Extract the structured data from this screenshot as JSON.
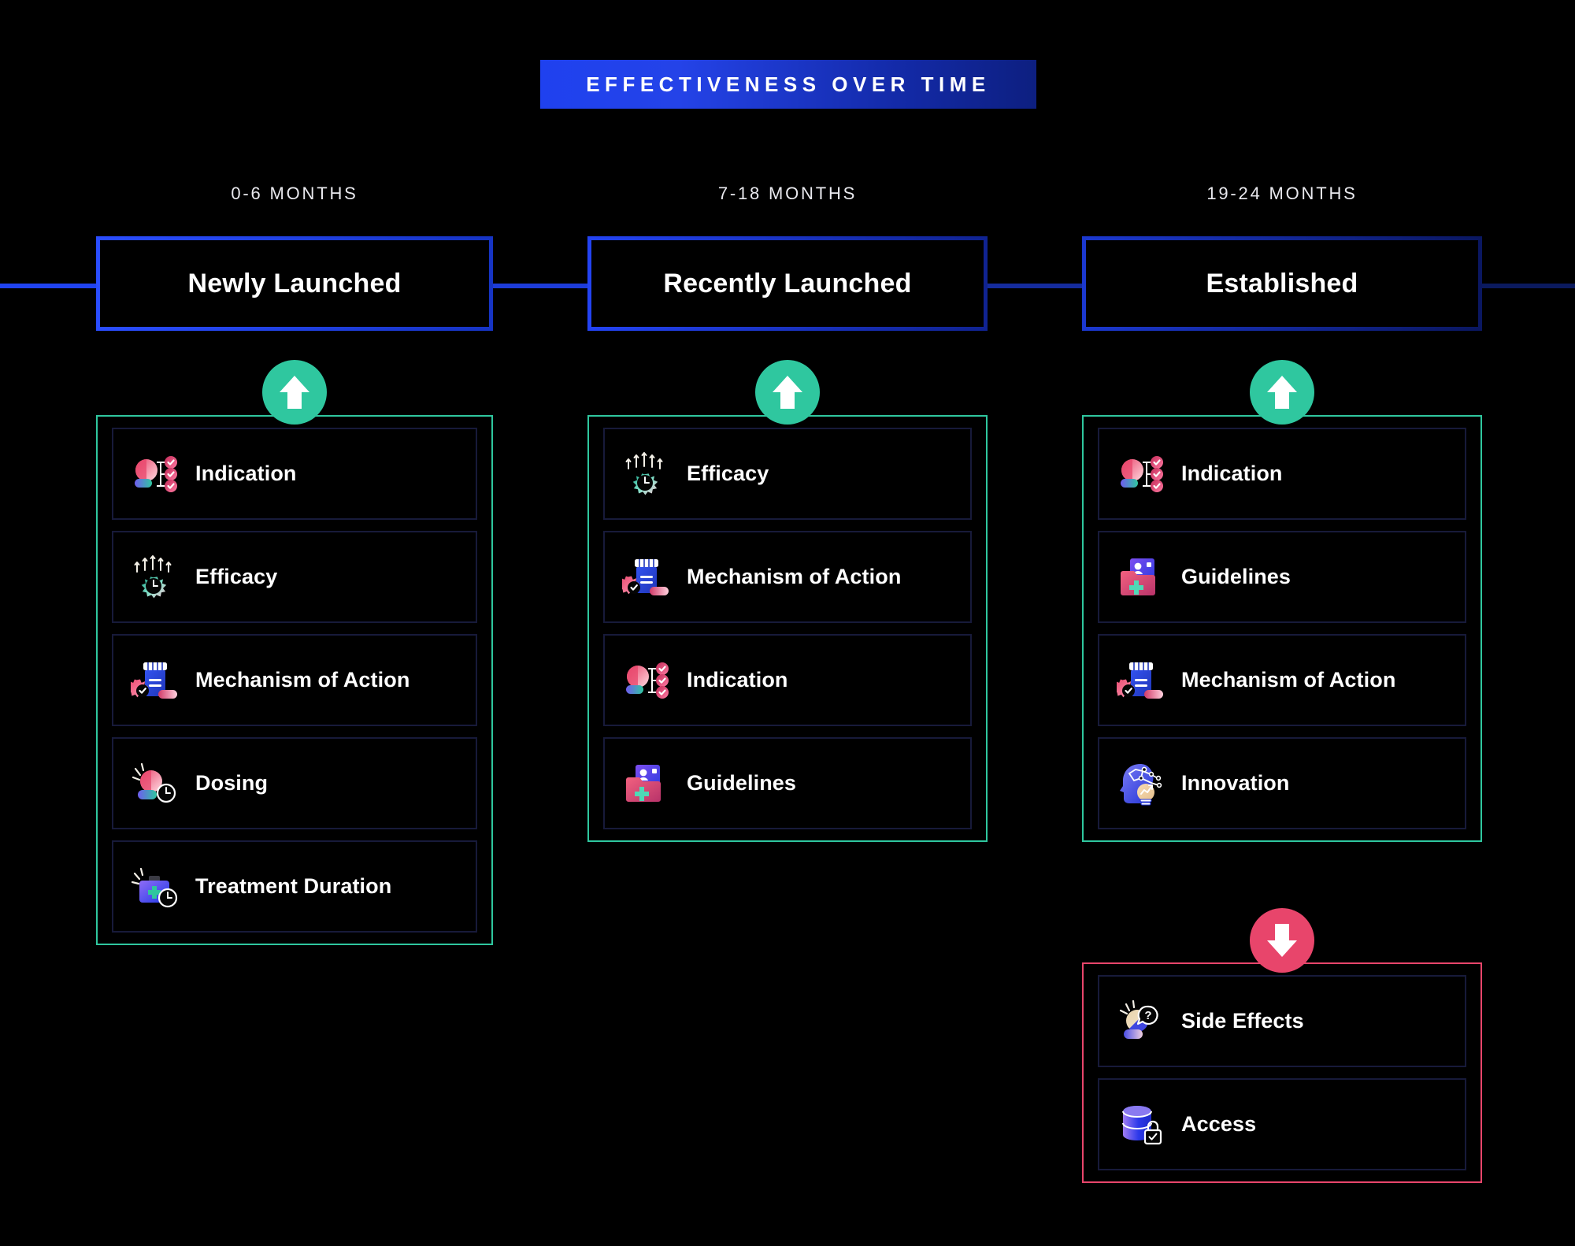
{
  "title": {
    "text": "EFFECTIVENESS OVER TIME",
    "background_gradient_from": "#1f41ef",
    "background_gradient_to": "#0d1f80"
  },
  "colors": {
    "page_background": "#000000",
    "accent_blue": "#2043f0",
    "positive_green": "#2fc79f",
    "negative_red": "#e8456b",
    "card_border": "#171a3a",
    "text": "#ffffff"
  },
  "stages": [
    {
      "period": "0-6 MONTHS",
      "name": "Newly Launched",
      "groups": [
        {
          "direction": "up",
          "direction_icon": "arrow-up-icon",
          "tone": "positive",
          "items": [
            {
              "label": "Indication",
              "icon": "indication-icon"
            },
            {
              "label": "Efficacy",
              "icon": "efficacy-icon"
            },
            {
              "label": "Mechanism of Action",
              "icon": "mechanism-of-action-icon"
            },
            {
              "label": "Dosing",
              "icon": "dosing-icon"
            },
            {
              "label": "Treatment Duration",
              "icon": "treatment-duration-icon"
            }
          ]
        }
      ]
    },
    {
      "period": "7-18 MONTHS",
      "name": "Recently Launched",
      "groups": [
        {
          "direction": "up",
          "direction_icon": "arrow-up-icon",
          "tone": "positive",
          "items": [
            {
              "label": "Efficacy",
              "icon": "efficacy-icon"
            },
            {
              "label": "Mechanism of Action",
              "icon": "mechanism-of-action-icon"
            },
            {
              "label": "Indication",
              "icon": "indication-icon"
            },
            {
              "label": "Guidelines",
              "icon": "guidelines-icon"
            }
          ]
        }
      ]
    },
    {
      "period": "19-24 MONTHS",
      "name": "Established",
      "groups": [
        {
          "direction": "up",
          "direction_icon": "arrow-up-icon",
          "tone": "positive",
          "items": [
            {
              "label": "Indication",
              "icon": "indication-icon"
            },
            {
              "label": "Guidelines",
              "icon": "guidelines-icon"
            },
            {
              "label": "Mechanism of Action",
              "icon": "mechanism-of-action-icon"
            },
            {
              "label": "Innovation",
              "icon": "innovation-icon"
            }
          ]
        },
        {
          "direction": "down",
          "direction_icon": "arrow-down-icon",
          "tone": "negative",
          "items": [
            {
              "label": "Side Effects",
              "icon": "side-effects-icon"
            },
            {
              "label": "Access",
              "icon": "access-icon"
            }
          ]
        }
      ]
    }
  ]
}
